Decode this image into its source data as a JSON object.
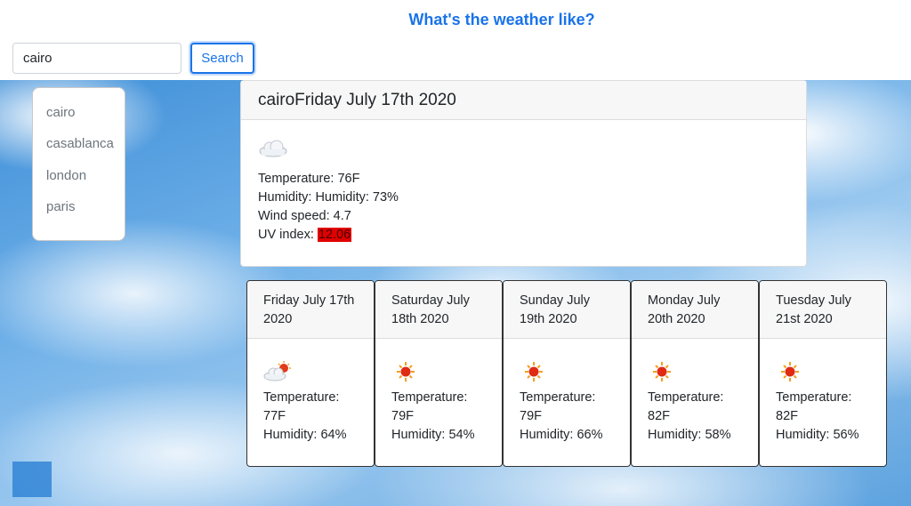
{
  "header": {
    "title": "What's the weather like?"
  },
  "search": {
    "value": "cairo",
    "button_label": "Search"
  },
  "history": [
    "cairo",
    "casablanca",
    "london",
    "paris"
  ],
  "today": {
    "title": "cairoFriday July 17th 2020",
    "icon": "cloud-icon",
    "temperature": "Temperature: 76F",
    "humidity": "Humidity: Humidity: 73%",
    "wind": "Wind speed: 4.7",
    "uv_label": "UV index: ",
    "uv_value": "12.06",
    "uv_color": "#e00000"
  },
  "forecast": [
    {
      "date": "Friday July 17th 2020",
      "icon": "partly-cloudy-icon",
      "temp_label": "Temperature:",
      "temp": "77F",
      "humidity": "Humidity: 64%"
    },
    {
      "date": "Saturday July 18th 2020",
      "icon": "sun-icon",
      "temp_label": "Temperature:",
      "temp": "79F",
      "humidity": "Humidity: 54%"
    },
    {
      "date": "Sunday July 19th 2020",
      "icon": "sun-icon",
      "temp_label": "Temperature:",
      "temp": "79F",
      "humidity": "Humidity: 66%"
    },
    {
      "date": "Monday July 20th 2020",
      "icon": "sun-icon",
      "temp_label": "Temperature:",
      "temp": "82F",
      "humidity": "Humidity: 58%"
    },
    {
      "date": "Tuesday July 21st 2020",
      "icon": "sun-icon",
      "temp_label": "Temperature:",
      "temp": "82F",
      "humidity": "Humidity: 56%"
    }
  ],
  "colors": {
    "accent": "#1a73e8",
    "uv_high": "#e00000"
  }
}
